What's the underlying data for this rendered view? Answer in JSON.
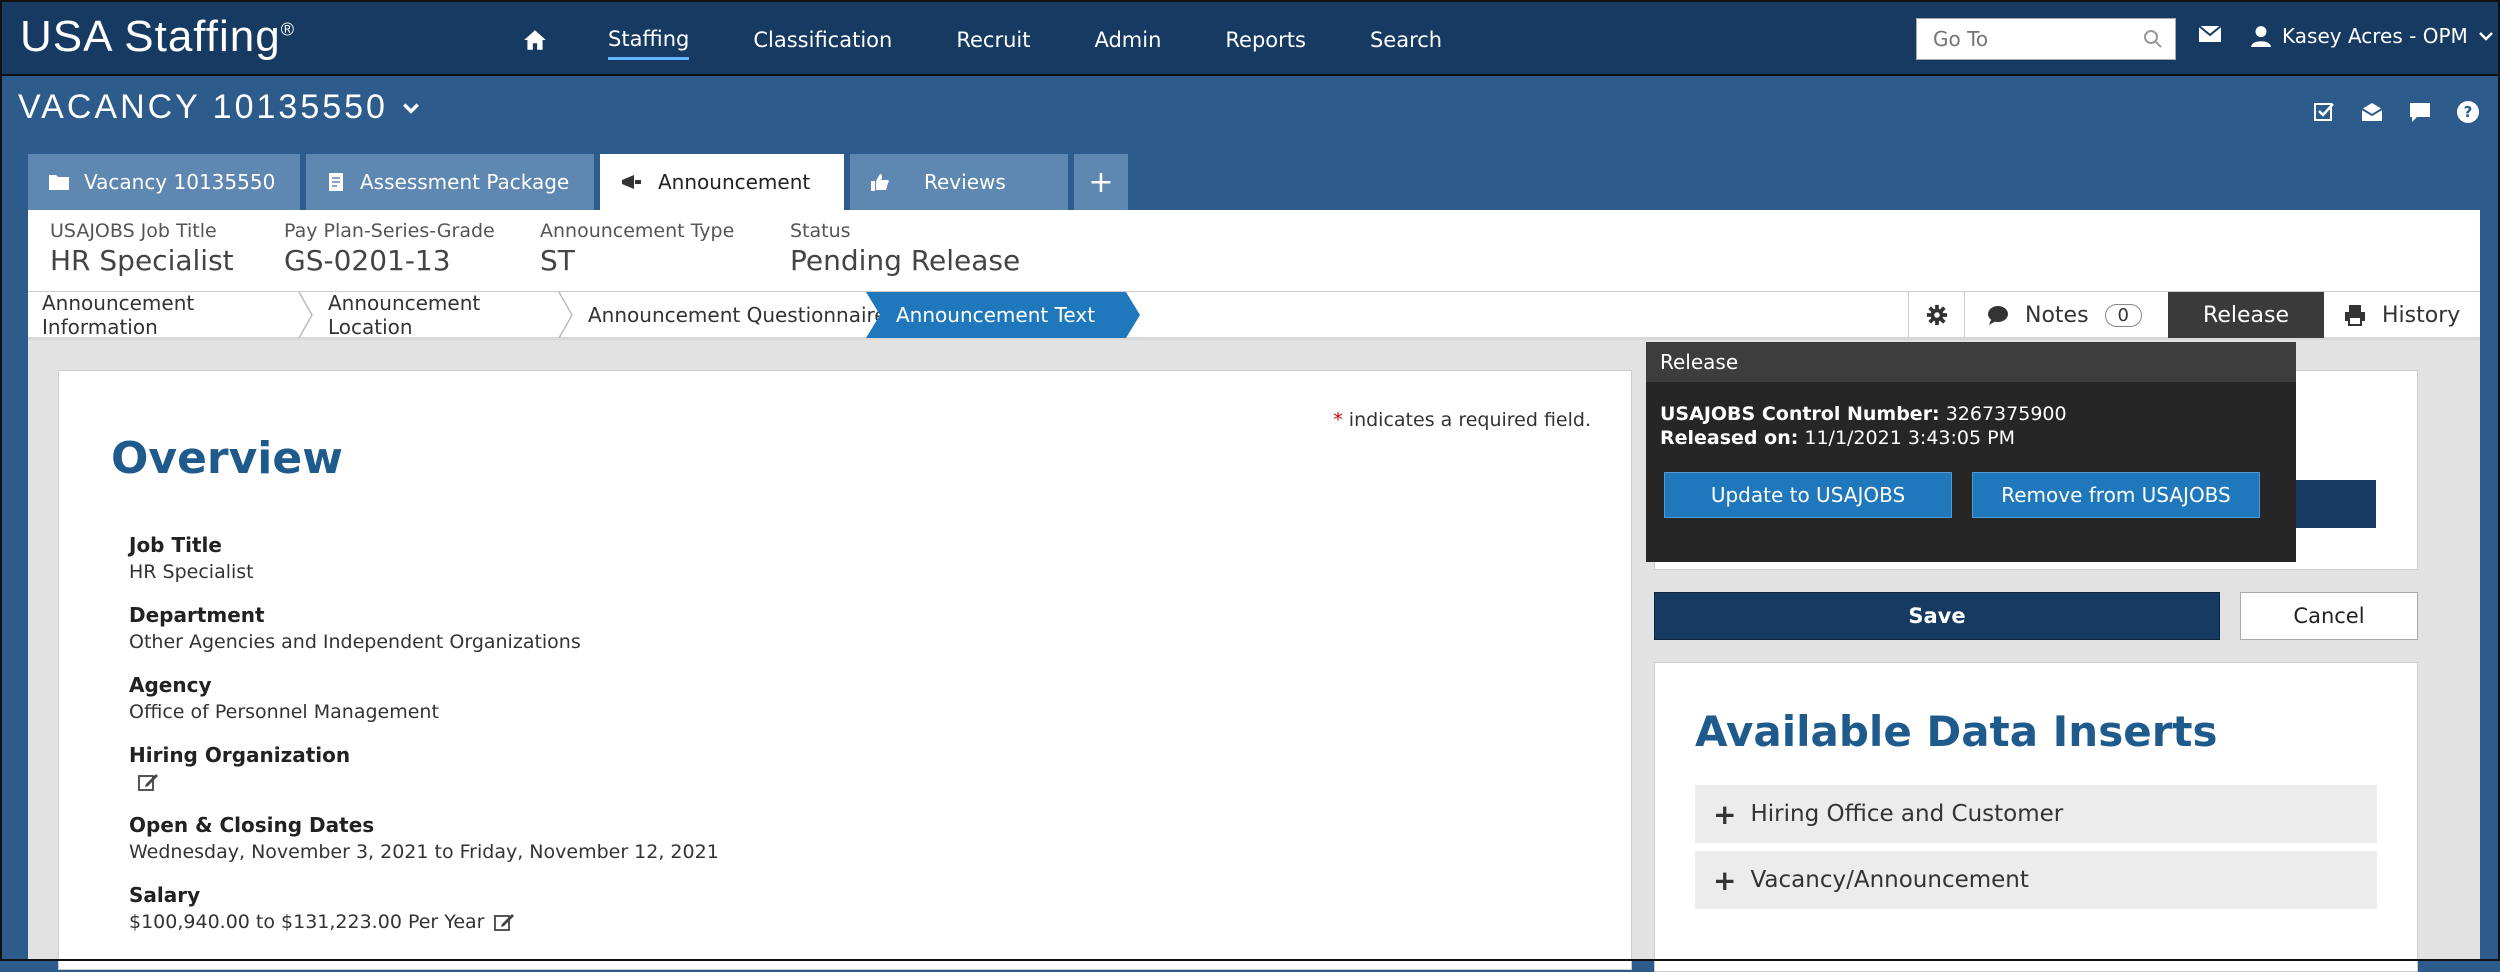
{
  "app": {
    "logo": "USA Staffing",
    "logo_mark": "®"
  },
  "nav": {
    "items": [
      {
        "label": "Staffing",
        "active": true
      },
      {
        "label": "Classification"
      },
      {
        "label": "Recruit"
      },
      {
        "label": "Admin"
      },
      {
        "label": "Reports"
      },
      {
        "label": "Search"
      }
    ],
    "goto_placeholder": "Go To",
    "user": "Kasey Acres - OPM"
  },
  "vacancy": {
    "title": "VACANCY 10135550"
  },
  "tabs": [
    {
      "label": "Vacancy 10135550"
    },
    {
      "label": "Assessment Package"
    },
    {
      "label": "Announcement",
      "active": true
    },
    {
      "label": "Reviews"
    },
    {
      "label": "+"
    }
  ],
  "info": {
    "job_title_label": "USAJOBS Job Title",
    "job_title": "HR Specialist",
    "pay_label": "Pay Plan-Series-Grade",
    "pay": "GS-0201-13",
    "type_label": "Announcement Type",
    "type": "ST",
    "status_label": "Status",
    "status": "Pending Release"
  },
  "steps": [
    {
      "label": "Announcement Information"
    },
    {
      "label": "Announcement Location"
    },
    {
      "label": "Announcement Questionnaire"
    },
    {
      "label": "Announcement Text",
      "active": true
    }
  ],
  "toolbar": {
    "notes_label": "Notes",
    "notes_count": "0",
    "release_label": "Release",
    "history_label": "History"
  },
  "main": {
    "required_star": "*",
    "required_note": " indicates a required field.",
    "overview_title": "Overview",
    "fields": [
      {
        "label": "Job Title",
        "value": "HR Specialist"
      },
      {
        "label": "Department",
        "value": "Other Agencies and Independent Organizations"
      },
      {
        "label": "Agency",
        "value": "Office of Personnel Management"
      },
      {
        "label": "Hiring Organization",
        "value": ""
      },
      {
        "label": "Open & Closing Dates",
        "value": "Wednesday, November 3, 2021 to Friday, November 12, 2021"
      },
      {
        "label": "Salary",
        "value": "$100,940.00 to $131,223.00 Per Year"
      }
    ]
  },
  "side": {
    "save_label": "Save",
    "cancel_label": "Cancel",
    "inserts_title": "Available Data Inserts",
    "accordions": [
      {
        "label": "Hiring Office and Customer"
      },
      {
        "label": "Vacancy/Announcement"
      }
    ]
  },
  "popover": {
    "title": "Release",
    "control_label": "USAJOBS Control Number:",
    "control_value": " 3267375900",
    "released_label": "Released on:",
    "released_value": " 11/1/2021 3:43:05 PM",
    "update_label": "Update to USAJOBS",
    "remove_label": "Remove from USAJOBS"
  },
  "colors": {
    "navbar": "#163a62",
    "accent": "#1f78bc",
    "heading": "#1f5a8c",
    "background": "#2d5c8c"
  }
}
